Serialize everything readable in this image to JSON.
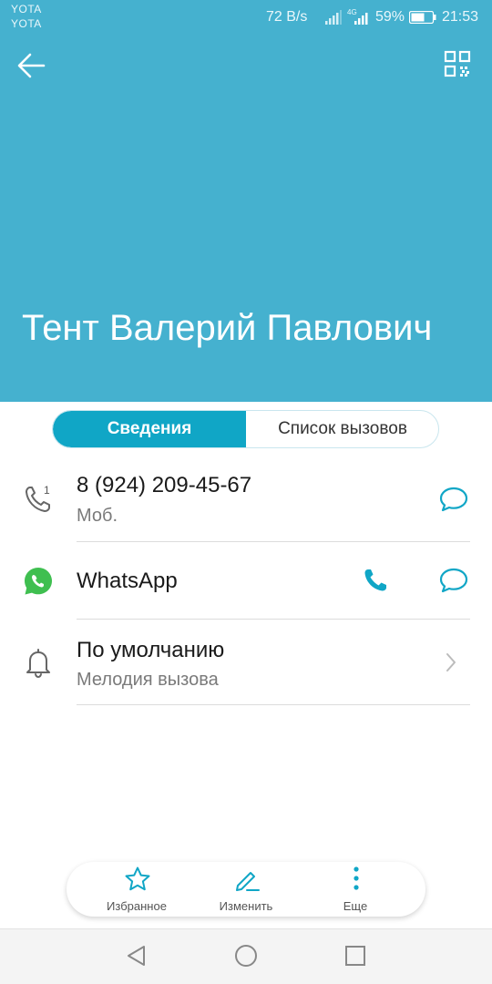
{
  "status_bar": {
    "carrier1": "YOTA",
    "carrier2": "YOTA",
    "speed": "72 B/s",
    "network_type": "4G",
    "battery": "59%",
    "time": "21:53"
  },
  "header": {
    "back_icon": "arrow-left-icon",
    "qr_icon": "qr-code-icon",
    "contact_name": "Тент Валерий Павлович",
    "background_color": "#45b1cf"
  },
  "tabs": {
    "details": "Сведения",
    "call_log": "Список вызовов",
    "active": "details",
    "accent_color": "#10a6c6"
  },
  "rows": {
    "phone": {
      "icon": "phone-icon",
      "sim": "1",
      "number": "8 (924) 209-45-67",
      "type": "Моб.",
      "action_icon": "message-icon"
    },
    "whatsapp": {
      "icon": "whatsapp-icon",
      "label": "WhatsApp",
      "call_icon": "phone-icon",
      "message_icon": "message-icon"
    },
    "ringtone": {
      "icon": "bell-icon",
      "value": "По умолчанию",
      "label": "Мелодия вызова",
      "action_icon": "chevron-right-icon"
    }
  },
  "action_bar": {
    "favorite": "Избранное",
    "edit": "Изменить",
    "more": "Еще"
  },
  "nav_bar": {
    "back": "triangle-back-icon",
    "home": "circle-home-icon",
    "recents": "square-recents-icon"
  }
}
